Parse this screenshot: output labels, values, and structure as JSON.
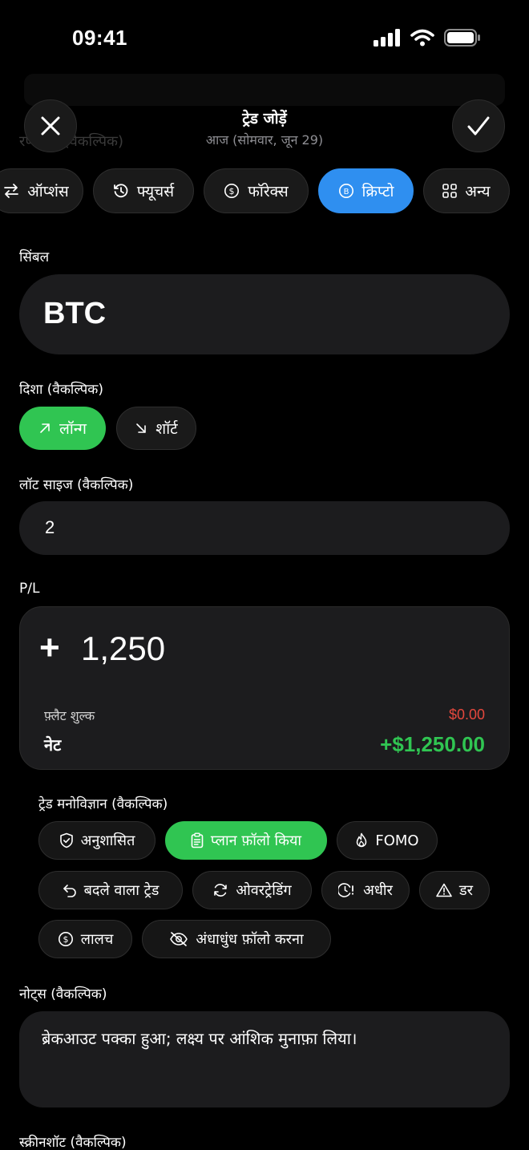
{
  "status_bar": {
    "time": "09:41"
  },
  "ghost": {
    "label": "रणनीति (वैकल्पिक)"
  },
  "header": {
    "title": "ट्रेड जोड़ें",
    "subtitle": "आज (सोमवार, जून 29)"
  },
  "categories": [
    {
      "label": "ऑप्शंस",
      "icon": "swap-icon"
    },
    {
      "label": "फ्यूचर्स",
      "icon": "history-icon"
    },
    {
      "label": "फॉरेक्स",
      "icon": "dollar-circle-icon"
    },
    {
      "label": "क्रिप्टो",
      "icon": "bitcoin-icon",
      "active": true
    },
    {
      "label": "अन्य",
      "icon": "grid-icon"
    }
  ],
  "symbol": {
    "label": "सिंबल",
    "value": "BTC"
  },
  "direction": {
    "label": "दिशा (वैकल्पिक)",
    "long_label": "लॉन्ग",
    "short_label": "शॉर्ट",
    "selected": "long"
  },
  "lot_size": {
    "label": "लॉट साइज (वैकल्पिक)",
    "value": "2"
  },
  "pl": {
    "label": "P/L",
    "sign": "+",
    "value": "1,250",
    "fee_label": "फ़्लैट शुल्क",
    "fee_value": "$0.00",
    "net_label": "नेट",
    "net_value": "+$1,250.00"
  },
  "psychology": {
    "label": "ट्रेड मनोविज्ञान (वैकल्पिक)",
    "chips": [
      {
        "label": "अनुशासित",
        "icon": "shield-check-icon"
      },
      {
        "label": "प्लान फ़ॉलो किया",
        "icon": "clipboard-icon",
        "active": true
      },
      {
        "label": "FOMO",
        "icon": "flame-icon"
      },
      {
        "label": "बदले वाला ट्रेड",
        "icon": "undo-icon"
      },
      {
        "label": "ओवरट्रेडिंग",
        "icon": "refresh-icon"
      },
      {
        "label": "अधीर",
        "icon": "clock-alert-icon"
      },
      {
        "label": "डर",
        "icon": "warning-icon"
      },
      {
        "label": "लालच",
        "icon": "dollar-circle-icon"
      },
      {
        "label": "अंधाधुंध फ़ॉलो करना",
        "icon": "eye-off-icon"
      }
    ]
  },
  "notes": {
    "label": "नोट्स (वैकल्पिक)",
    "value": "ब्रेकआउट पक्का हुआ; लक्ष्य पर आंशिक मुनाफ़ा लिया।"
  },
  "screenshot": {
    "label": "स्क्रीनशॉट (वैकल्पिक)"
  },
  "colors": {
    "accent_blue": "#2f8ff0",
    "success_green": "#30c552",
    "danger_red": "#e5483d",
    "surface": "#1c1c1e"
  }
}
